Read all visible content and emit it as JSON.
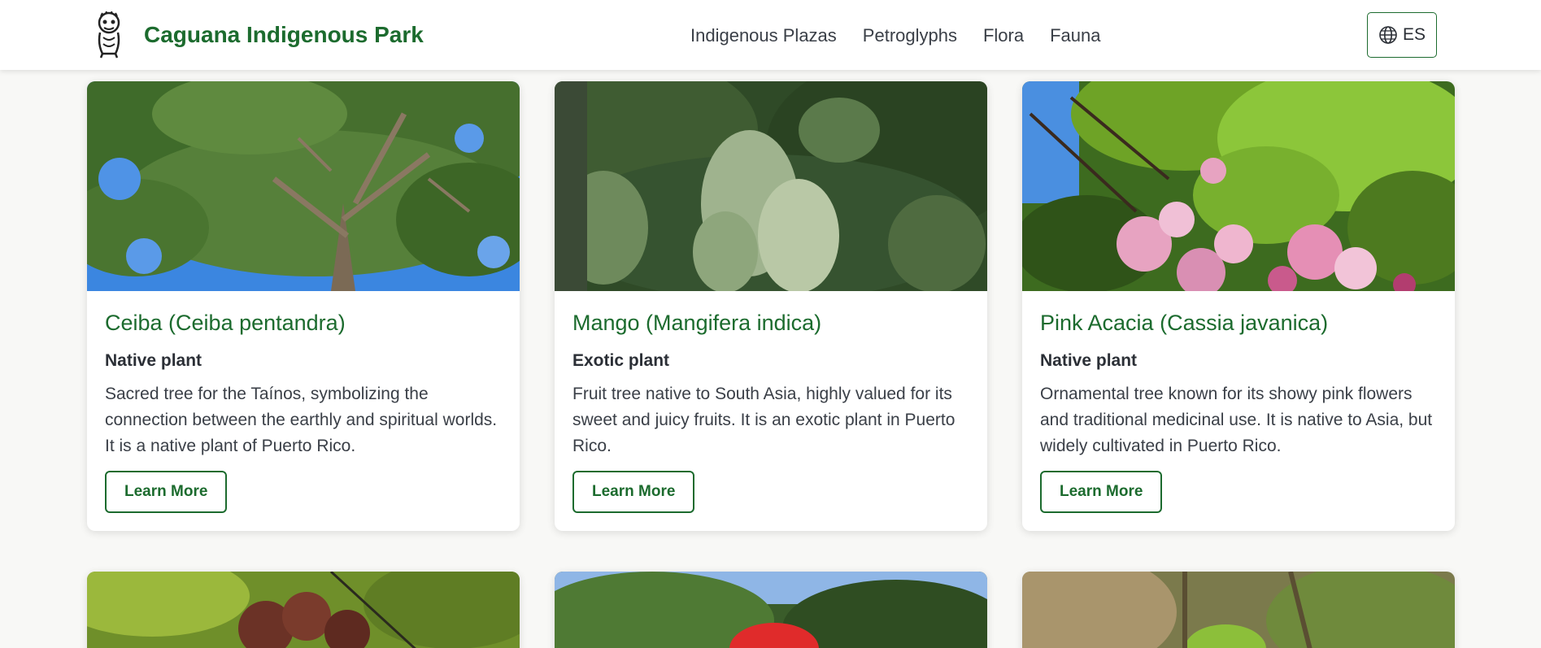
{
  "header": {
    "brand": "Caguana Indigenous Park",
    "nav": [
      "Indigenous Plazas",
      "Petroglyphs",
      "Flora",
      "Fauna"
    ],
    "lang_label": "ES"
  },
  "cards": [
    {
      "title": "Ceiba (Ceiba pentandra)",
      "type": "Native plant",
      "description": "Sacred tree for the Taínos, symbolizing the connection between the earthly and spiritual worlds. It is a native plant of Puerto Rico.",
      "button": "Learn More"
    },
    {
      "title": "Mango (Mangifera indica)",
      "type": "Exotic plant",
      "description": "Fruit tree native to South Asia, highly valued for its sweet and juicy fruits. It is an exotic plant in Puerto Rico.",
      "button": "Learn More"
    },
    {
      "title": "Pink Acacia (Cassia javanica)",
      "type": "Native plant",
      "description": "Ornamental tree known for its showy pink flowers and traditional medicinal use. It is native to Asia, but widely cultivated in Puerto Rico.",
      "button": "Learn More"
    }
  ],
  "colors": {
    "brand_green": "#1c6b2e",
    "page_bg": "#f8f8f6",
    "text": "#2b2f36"
  }
}
